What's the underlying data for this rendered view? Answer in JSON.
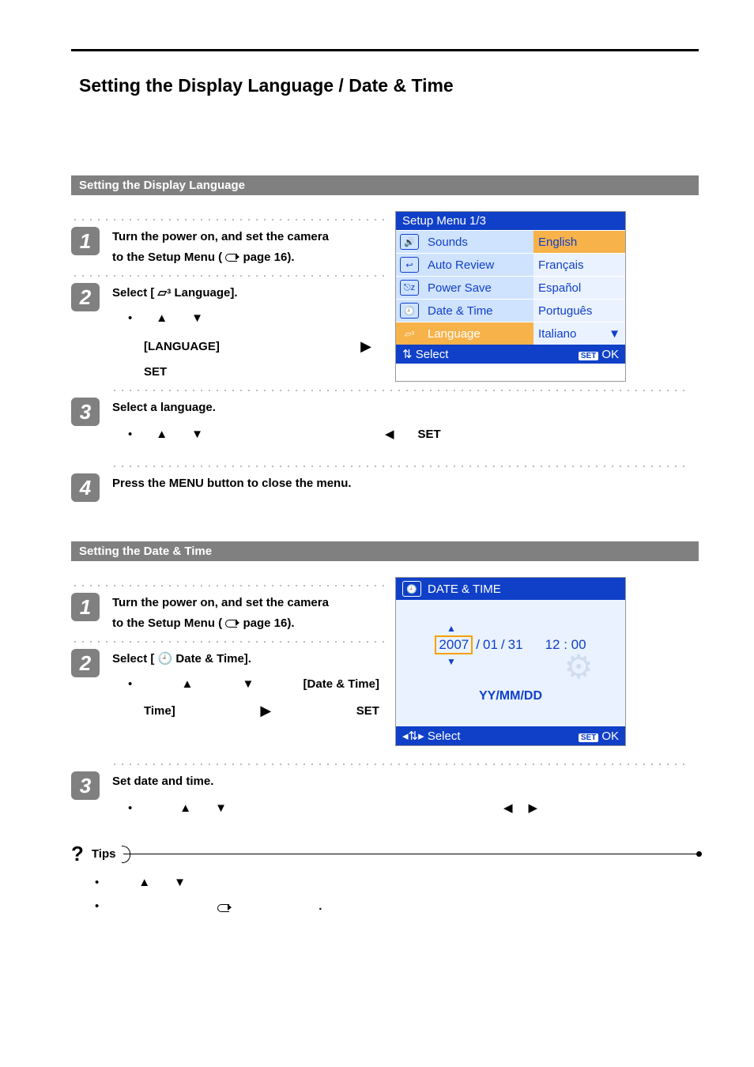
{
  "title": "Setting the Display Language / Date & Time",
  "section1": {
    "heading": "Setting the Display Language",
    "step1": {
      "num": "1",
      "text_a": "Turn the power on, and set the camera",
      "text_b": "to the Setup Menu (",
      "text_c": "page 16)."
    },
    "step2": {
      "num": "2",
      "text": "Select [",
      "suffix": "  Language].",
      "sub_a": "[LANGUAGE]",
      "sub_b": "SET"
    },
    "step3": {
      "num": "3",
      "text": "Select a language.",
      "set": "SET"
    },
    "step4": {
      "num": "4",
      "text": "Press the MENU button to close the menu."
    }
  },
  "screen1": {
    "title": "Setup Menu 1/3",
    "rows": [
      {
        "label": "Sounds",
        "value": "English"
      },
      {
        "label": "Auto Review",
        "value": "Français"
      },
      {
        "label": "Power Save",
        "value": "Español"
      },
      {
        "label": "Date & Time",
        "value": "Português"
      },
      {
        "label": "Language",
        "value": "Italiano"
      }
    ],
    "foot_select": "Select",
    "foot_ok": "OK"
  },
  "section2": {
    "heading": "Setting the Date & Time",
    "step1": {
      "num": "1",
      "text_a": "Turn the power on, and set the camera",
      "text_b": "to the Setup Menu (",
      "text_c": "page 16)."
    },
    "step2": {
      "num": "2",
      "text": "Select [",
      "suffix": "  Date & Time].",
      "sub_a": "[Date & Time]",
      "sub_b": "SET"
    },
    "step3": {
      "num": "3",
      "text": "Set date and time."
    }
  },
  "screen2": {
    "title": "DATE & TIME",
    "year": "2007",
    "month": "01",
    "day": "31",
    "time": "12 : 00",
    "format": "YY/MM/DD",
    "foot_select": "Select",
    "foot_ok": "OK"
  },
  "tips": {
    "label": "Tips"
  }
}
